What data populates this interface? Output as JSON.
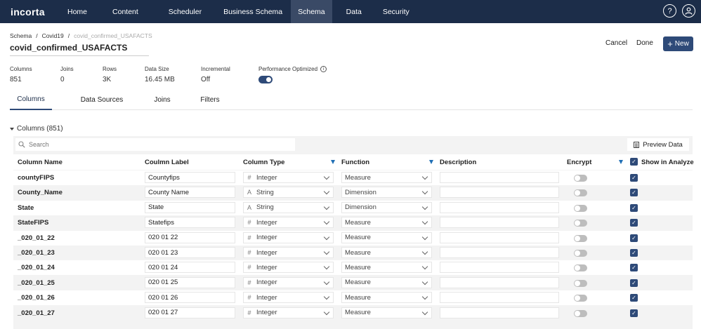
{
  "nav": {
    "logo": "incorta",
    "items": [
      "Home",
      "Content",
      "Scheduler",
      "Business Schema",
      "Schema",
      "Data",
      "Security"
    ],
    "active": "Schema",
    "help_icon": "question-circle-icon",
    "user_icon": "user-circle-icon"
  },
  "breadcrumb": [
    "Schema",
    "Covid19",
    "covid_confirmed_USAFACTS"
  ],
  "breadcrumb_sep": "/",
  "title": "covid_confirmed_USAFACTS",
  "actions": {
    "cancel": "Cancel",
    "done": "Done",
    "new": "New",
    "new_icon": "+"
  },
  "stats": {
    "columns": {
      "label": "Columns",
      "value": "851"
    },
    "joins": {
      "label": "Joins",
      "value": "0"
    },
    "rows": {
      "label": "Rows",
      "value": "3K"
    },
    "data_size": {
      "label": "Data Size",
      "value": "16.45 MB"
    },
    "incremental": {
      "label": "Incremental",
      "value": "Off"
    },
    "performance": {
      "label": "Performance Optimized",
      "enabled": true,
      "info": "i"
    }
  },
  "tabs": [
    "Columns",
    "Data Sources",
    "Joins",
    "Filters"
  ],
  "active_tab": "Columns",
  "section_title": "Columns (851)",
  "search": {
    "placeholder": "Search"
  },
  "preview_button": "Preview Data",
  "table": {
    "headers": {
      "name": "Column Name",
      "label": "Coulmn Label",
      "type": "Column Type",
      "function": "Function",
      "description": "Description",
      "encrypt": "Encrypt",
      "show": "Show in Analyze"
    },
    "rows": [
      {
        "name": "countyFIPS",
        "label": "Countyfips",
        "type_icon": "#",
        "type": "Integer",
        "function": "Measure",
        "encrypt": false,
        "show": true
      },
      {
        "name": "County_Name",
        "label": "County Name",
        "type_icon": "A",
        "type": "String",
        "function": "Dimension",
        "encrypt": false,
        "show": true
      },
      {
        "name": "State",
        "label": "State",
        "type_icon": "A",
        "type": "String",
        "function": "Dimension",
        "encrypt": false,
        "show": true
      },
      {
        "name": "StateFIPS",
        "label": "Statefips",
        "type_icon": "#",
        "type": "Integer",
        "function": "Measure",
        "encrypt": false,
        "show": true
      },
      {
        "name": "_020_01_22",
        "label": "020 01 22",
        "type_icon": "#",
        "type": "Integer",
        "function": "Measure",
        "encrypt": false,
        "show": true
      },
      {
        "name": "_020_01_23",
        "label": "020 01 23",
        "type_icon": "#",
        "type": "Integer",
        "function": "Measure",
        "encrypt": false,
        "show": true
      },
      {
        "name": "_020_01_24",
        "label": "020 01 24",
        "type_icon": "#",
        "type": "Integer",
        "function": "Measure",
        "encrypt": false,
        "show": true
      },
      {
        "name": "_020_01_25",
        "label": "020 01 25",
        "type_icon": "#",
        "type": "Integer",
        "function": "Measure",
        "encrypt": false,
        "show": true
      },
      {
        "name": "_020_01_26",
        "label": "020 01 26",
        "type_icon": "#",
        "type": "Integer",
        "function": "Measure",
        "encrypt": false,
        "show": true
      },
      {
        "name": "_020_01_27",
        "label": "020 01 27",
        "type_icon": "#",
        "type": "Integer",
        "function": "Measure",
        "encrypt": false,
        "show": true
      }
    ]
  },
  "colors": {
    "nav_bg": "#1c2d49",
    "accent": "#2e4a78",
    "filter": "#1f6fb5"
  }
}
